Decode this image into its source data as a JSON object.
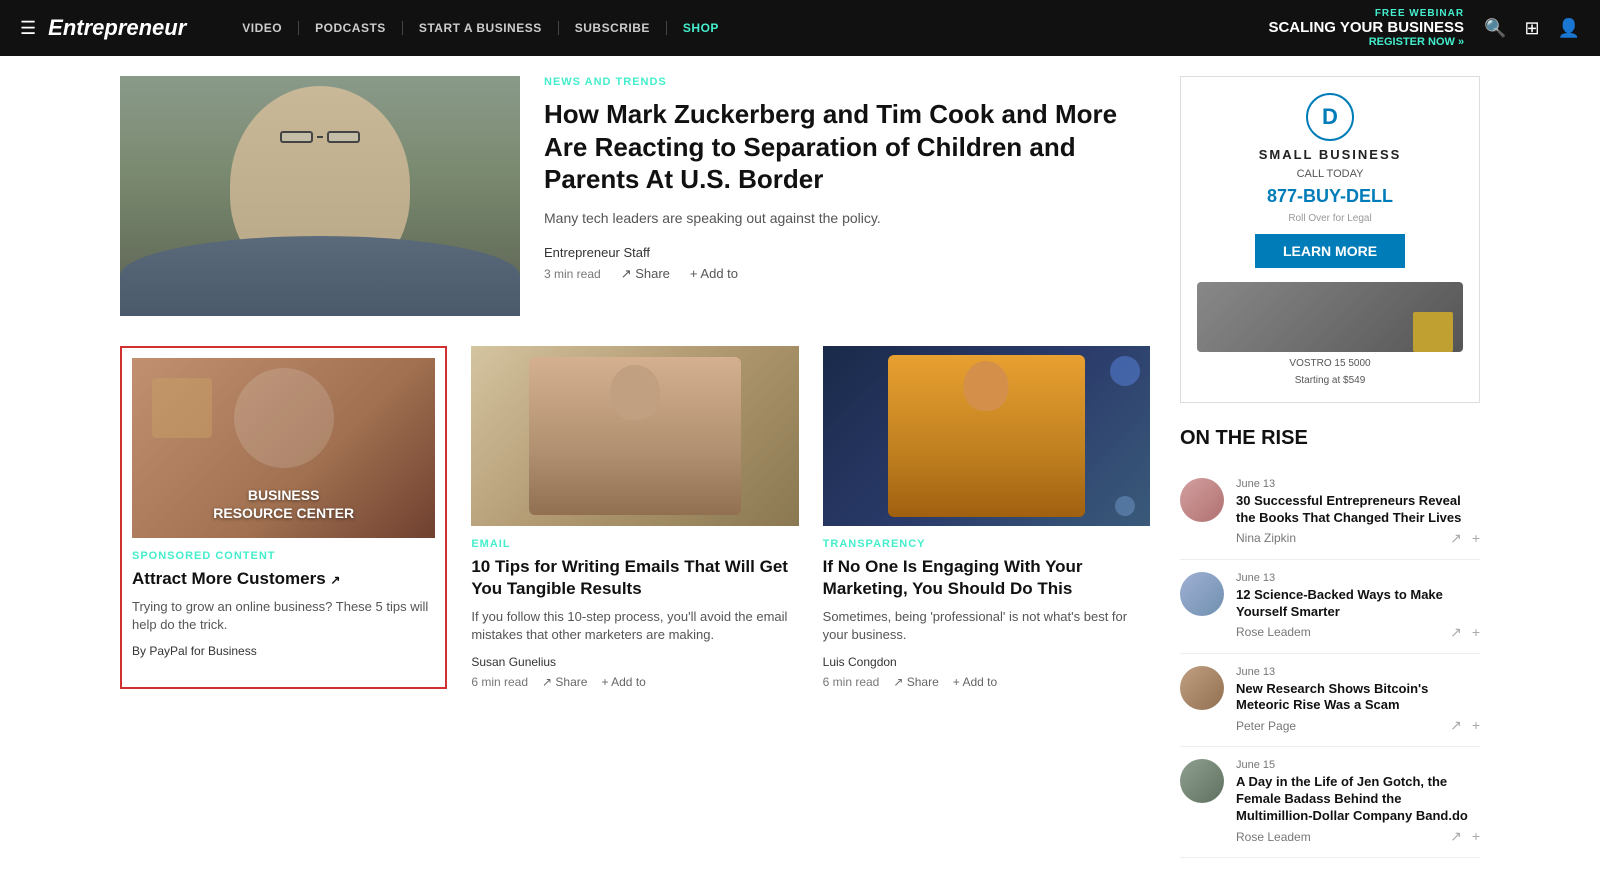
{
  "header": {
    "logo": "Entrepreneur",
    "hamburger_icon": "☰",
    "nav_items": [
      {
        "label": "VIDEO",
        "shop": false
      },
      {
        "label": "PODCASTS",
        "shop": false
      },
      {
        "label": "START A BUSINESS",
        "shop": false
      },
      {
        "label": "SUBSCRIBE",
        "shop": false
      },
      {
        "label": "SHOP",
        "shop": true
      }
    ],
    "webinar": {
      "free_label": "FREE WEBINAR",
      "title": "SCALING YOUR BUSINESS",
      "register": "REGISTER NOW »"
    },
    "search_icon": "🔍",
    "add_icon": "⊞",
    "user_icon": "👤"
  },
  "featured": {
    "category": "NEWS AND TRENDS",
    "title": "How Mark Zuckerberg and Tim Cook and More Are Reacting to Separation of Children and Parents At U.S. Border",
    "excerpt": "Many tech leaders are speaking out against the policy.",
    "author": "Entrepreneur Staff",
    "read_time": "3 min read",
    "share_label": "Share",
    "addto_label": "Add to"
  },
  "articles": [
    {
      "id": "brc",
      "highlighted": true,
      "category": "SPONSORED CONTENT",
      "brc_line1": "BUSINESS",
      "brc_line2": "RESOURCE CENTER",
      "title": "Attract More Customers ↗",
      "title_plain": "Attract More Customers",
      "excerpt": "Trying to grow an online business? These 5 tips will help do the trick.",
      "by_author": "By PayPal for Business"
    },
    {
      "id": "email",
      "highlighted": false,
      "category": "EMAIL",
      "title": "10 Tips for Writing Emails That Will Get You Tangible Results",
      "excerpt": "If you follow this 10-step process, you'll avoid the email mistakes that other marketers are making.",
      "author": "Susan Gunelius",
      "read_time": "6 min read",
      "share_label": "Share",
      "addto_label": "Add to"
    },
    {
      "id": "transparency",
      "highlighted": false,
      "category": "TRANSPARENCY",
      "title": "If No One Is Engaging With Your Marketing, You Should Do This",
      "excerpt": "Sometimes, being 'professional' is not what's best for your business.",
      "author": "Luis Congdon",
      "read_time": "6 min read",
      "share_label": "Share",
      "addto_label": "Add to"
    }
  ],
  "ad": {
    "logo": "DELL",
    "small_biz": "SMALL BUSINESS",
    "call_today": "CALL TODAY",
    "phone": "877-BUY-DELL",
    "legal": "Roll Over for Legal",
    "cta": "LEARN MORE",
    "product": "VOSTRO 15 5000",
    "price": "Starting at $549"
  },
  "on_the_rise": {
    "title": "ON THE RISE",
    "items": [
      {
        "date": "June 13",
        "title": "30 Successful Entrepreneurs Reveal the Books That Changed Their Lives",
        "author": "Nina Zipkin",
        "avatar_class": "avatar-1"
      },
      {
        "date": "June 13",
        "title": "12 Science-Backed Ways to Make Yourself Smarter",
        "author": "Rose Leadem",
        "avatar_class": "avatar-2"
      },
      {
        "date": "June 13",
        "title": "New Research Shows Bitcoin's Meteoric Rise Was a Scam",
        "author": "Peter Page",
        "avatar_class": "avatar-3"
      },
      {
        "date": "June 15",
        "title": "A Day in the Life of Jen Gotch, the Female Badass Behind the Multimillion-Dollar Company Band.do",
        "author": "Rose Leadem",
        "avatar_class": "avatar-4"
      }
    ]
  }
}
